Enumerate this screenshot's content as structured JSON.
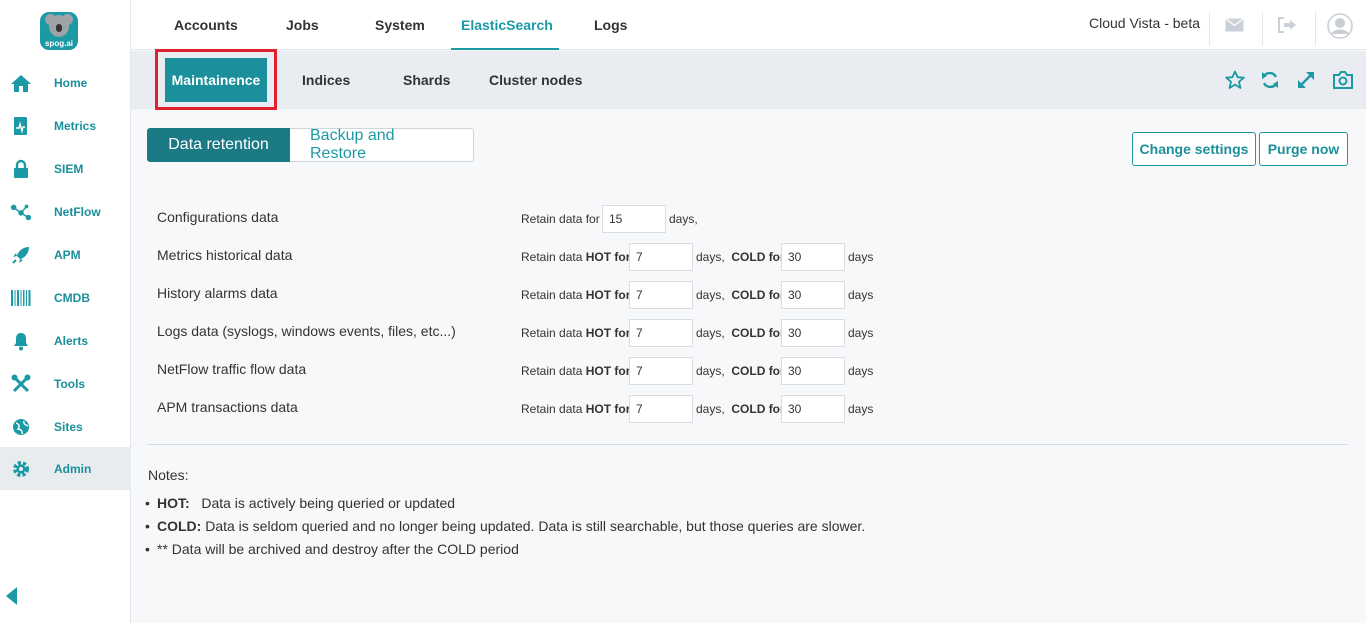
{
  "logo": {
    "brand_text": "spog.ai"
  },
  "sidebar": {
    "items": [
      {
        "label": "Home",
        "icon": "home-icon"
      },
      {
        "label": "Metrics",
        "icon": "metrics-icon"
      },
      {
        "label": "SIEM",
        "icon": "lock-icon"
      },
      {
        "label": "NetFlow",
        "icon": "netflow-icon"
      },
      {
        "label": "APM",
        "icon": "rocket-icon"
      },
      {
        "label": "CMDB",
        "icon": "barcode-icon"
      },
      {
        "label": "Alerts",
        "icon": "bell-icon"
      },
      {
        "label": "Tools",
        "icon": "tools-icon"
      },
      {
        "label": "Sites",
        "icon": "globe-icon"
      },
      {
        "label": "Admin",
        "icon": "gear-icon"
      }
    ],
    "active": "Admin"
  },
  "topbar": {
    "tabs": [
      "Accounts",
      "Jobs",
      "System",
      "ElasticSearch",
      "Logs"
    ],
    "active_tab": "ElasticSearch",
    "brand_title": "Cloud Vista - beta"
  },
  "subbar": {
    "tabs": [
      "Maintainence",
      "Indices",
      "Shards",
      "Cluster nodes"
    ],
    "active_tab": "Maintainence"
  },
  "segments": {
    "active": "Data retention",
    "inactive": "Backup and Restore"
  },
  "buttons": {
    "change_settings": "Change settings",
    "purge_now": "Purge now"
  },
  "retention": {
    "retain_for": "Retain data for",
    "retain_hot_prefix": "Retain data",
    "hot_for": "HOT for",
    "days_comma": "days,",
    "cold_for": "COLD for",
    "days": "days",
    "rows": [
      {
        "label": "Configurations data",
        "value": "15"
      },
      {
        "label": "Metrics historical data",
        "hot": "7",
        "cold": "30"
      },
      {
        "label": "History alarms data",
        "hot": "7",
        "cold": "30"
      },
      {
        "label": "Logs data (syslogs, windows events, files, etc...)",
        "hot": "7",
        "cold": "30"
      },
      {
        "label": "NetFlow traffic flow data",
        "hot": "7",
        "cold": "30"
      },
      {
        "label": "APM transactions data",
        "hot": "7",
        "cold": "30"
      }
    ]
  },
  "notes": {
    "title": "Notes:",
    "items": [
      {
        "term": "HOT:",
        "text": "Data is actively being queried or updated"
      },
      {
        "term": "COLD:",
        "text": "Data is seldom queried and no longer being updated. Data is still searchable, but those queries are slower."
      },
      {
        "term": "",
        "text": "** Data will be archived and destroy after the COLD period"
      }
    ]
  },
  "colors": {
    "accent": "#1b9aa5",
    "accent_dark": "#1b7a84",
    "highlight_border": "#e0202c"
  }
}
